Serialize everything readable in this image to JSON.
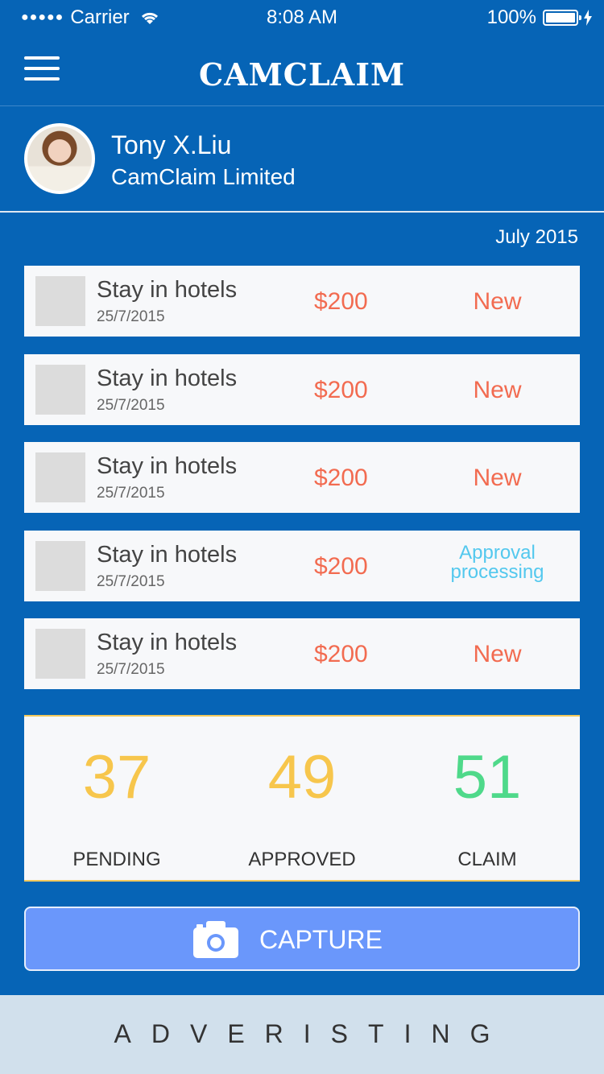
{
  "status_bar": {
    "signal_dots": "●●●●●",
    "carrier": "Carrier",
    "time": "8:08 AM",
    "battery": "100%"
  },
  "nav": {
    "logo": "CAMCLAIM",
    "menu_icon": "hamburger-menu-icon"
  },
  "profile": {
    "name": "Tony X.Liu",
    "company": "CamClaim Limited"
  },
  "month_label": "July  2015",
  "claims": [
    {
      "title": "Stay in hotels",
      "date": "25/7/2015",
      "amount": "$200",
      "status": "New"
    },
    {
      "title": "Stay in hotels",
      "date": "25/7/2015",
      "amount": "$200",
      "status": "New"
    },
    {
      "title": "Stay in hotels",
      "date": "25/7/2015",
      "amount": "$200",
      "status": "New"
    },
    {
      "title": "Stay in hotels",
      "date": "25/7/2015",
      "amount": "$200",
      "status_line1": "Approval",
      "status_line2": "processing"
    },
    {
      "title": "Stay in hotels",
      "date": "25/7/2015",
      "amount": "$200",
      "status": "New"
    }
  ],
  "summary": {
    "pending": {
      "value": "37",
      "label": "PENDING"
    },
    "approved": {
      "value": "49",
      "label": "APPROVED"
    },
    "claim": {
      "value": "51",
      "label": "CLAIM"
    }
  },
  "capture": {
    "label": "CAPTURE",
    "icon": "camera-icon"
  },
  "ad": {
    "text": "ADVERISTING"
  },
  "colors": {
    "primary_blue": "#0664b6",
    "amount_red": "#f26b50",
    "approval_cyan": "#53c8ee",
    "pending_yellow": "#f7c64c",
    "claim_green": "#4fd98a",
    "capture_blue": "#6a97fb",
    "ad_background": "#d1e0ec"
  }
}
